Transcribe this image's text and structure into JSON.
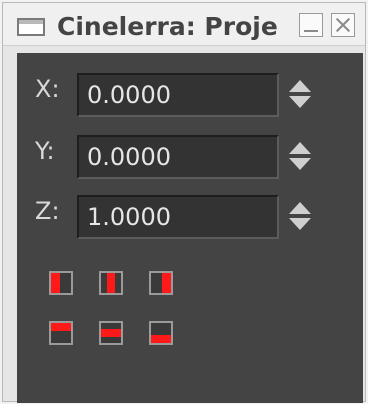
{
  "window": {
    "title": "Cinelerra: Proje",
    "icons": {
      "app": "window-icon",
      "minimize": "minimize-icon",
      "close": "close-icon"
    }
  },
  "fields": {
    "x": {
      "label": "X:",
      "value": "0.0000"
    },
    "y": {
      "label": "Y:",
      "value": "0.0000"
    },
    "z": {
      "label": "Z:",
      "value": "1.0000"
    }
  },
  "align_buttons": [
    {
      "name": "align-left",
      "icon": "align-left-icon"
    },
    {
      "name": "align-center-horizontal",
      "icon": "align-center-horizontal-icon"
    },
    {
      "name": "align-right",
      "icon": "align-right-icon"
    },
    {
      "name": "align-top",
      "icon": "align-top-icon"
    },
    {
      "name": "align-center-vertical",
      "icon": "align-center-vertical-icon"
    },
    {
      "name": "align-bottom",
      "icon": "align-bottom-icon"
    }
  ],
  "colors": {
    "panel": "#444444",
    "field": "#333333",
    "accent": "#ff1a1a"
  }
}
